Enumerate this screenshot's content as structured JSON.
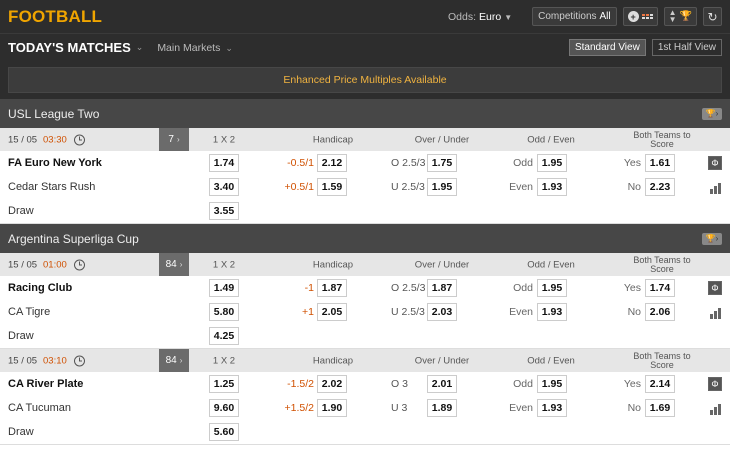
{
  "header": {
    "sport_title": "FOOTBALL",
    "odds_label": "Odds:",
    "odds_value": "Euro",
    "competitions_label": "Competitions",
    "competitions_value": "All"
  },
  "subheader": {
    "title": "TODAY'S MATCHES",
    "markets_label": "Main Markets",
    "standard_view": "Standard View",
    "first_half_view": "1st Half View"
  },
  "banner": {
    "text": "Enhanced Price Multiples Available"
  },
  "columns": {
    "c1x2": "1 X 2",
    "handicap": "Handicap",
    "over_under": "Over / Under",
    "odd_even": "Odd / Even",
    "btts_line1": "Both Teams to",
    "btts_line2": "Score"
  },
  "leagues": [
    {
      "name": "USL League Two",
      "matches": [
        {
          "date": "15 / 05",
          "time": "03:30",
          "markets_count": "7",
          "home": {
            "name": "FA Euro New York",
            "odds": "1.74",
            "hcap": "-0.5/1",
            "hcap_odds": "2.12",
            "ou": "O 2.5/3",
            "ou_odds": "1.75",
            "oe": "Odd",
            "oe_odds": "1.95",
            "bts": "Yes",
            "bts_odds": "1.61"
          },
          "away": {
            "name": "Cedar Stars Rush",
            "odds": "3.40",
            "hcap": "+0.5/1",
            "hcap_odds": "1.59",
            "ou": "U 2.5/3",
            "ou_odds": "1.95",
            "oe": "Even",
            "oe_odds": "1.93",
            "bts": "No",
            "bts_odds": "2.23"
          },
          "draw": {
            "name": "Draw",
            "odds": "3.55"
          }
        }
      ]
    },
    {
      "name": "Argentina Superliga Cup",
      "matches": [
        {
          "date": "15 / 05",
          "time": "01:00",
          "markets_count": "84",
          "home": {
            "name": "Racing Club",
            "odds": "1.49",
            "hcap": "-1",
            "hcap_odds": "1.87",
            "ou": "O 2.5/3",
            "ou_odds": "1.87",
            "oe": "Odd",
            "oe_odds": "1.95",
            "bts": "Yes",
            "bts_odds": "1.74"
          },
          "away": {
            "name": "CA Tigre",
            "odds": "5.80",
            "hcap": "+1",
            "hcap_odds": "2.05",
            "ou": "U 2.5/3",
            "ou_odds": "2.03",
            "oe": "Even",
            "oe_odds": "1.93",
            "bts": "No",
            "bts_odds": "2.06"
          },
          "draw": {
            "name": "Draw",
            "odds": "4.25"
          }
        },
        {
          "date": "15 / 05",
          "time": "03:10",
          "markets_count": "84",
          "home": {
            "name": "CA River Plate",
            "odds": "1.25",
            "hcap": "-1.5/2",
            "hcap_odds": "2.02",
            "ou": "O 3",
            "ou_odds": "2.01",
            "oe": "Odd",
            "oe_odds": "1.95",
            "bts": "Yes",
            "bts_odds": "2.14"
          },
          "away": {
            "name": "CA Tucuman",
            "odds": "9.60",
            "hcap": "+1.5/2",
            "hcap_odds": "1.90",
            "ou": "U 3",
            "ou_odds": "1.89",
            "oe": "Even",
            "oe_odds": "1.93",
            "bts": "No",
            "bts_odds": "1.69"
          },
          "draw": {
            "name": "Draw",
            "odds": "5.60"
          }
        }
      ]
    }
  ],
  "colors": {
    "accent": "#f0a500",
    "time": "#d05000",
    "header_bg": "#2d2d2d",
    "league_bg": "#474747"
  },
  "icons": {
    "add": "plus-icon",
    "live": "live-grid-icon",
    "sort": "sort-icon",
    "trophy": "trophy-icon",
    "refresh": "refresh-icon",
    "clock": "clock-icon",
    "stats": "stats-bars-icon",
    "pitch": "pitch-icon"
  }
}
